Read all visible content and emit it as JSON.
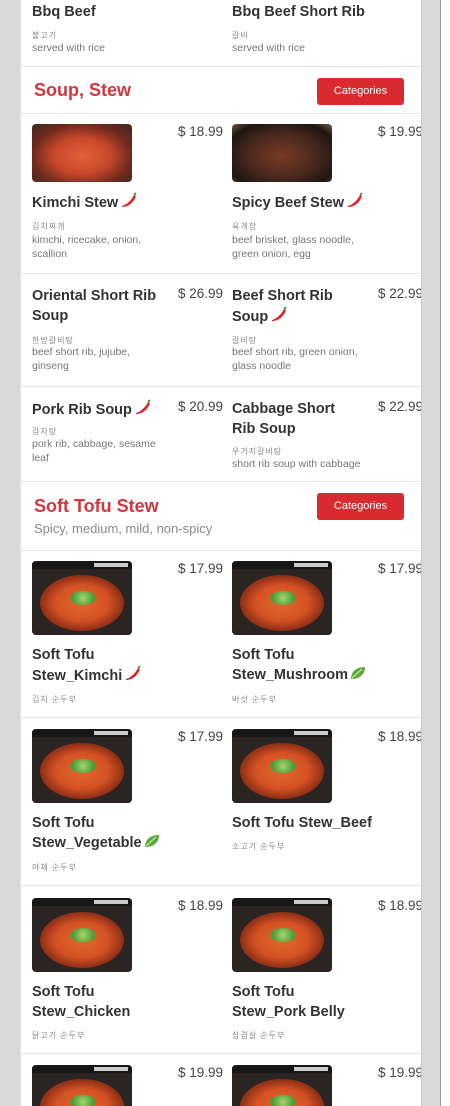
{
  "colors": {
    "accent": "#d92a2f",
    "title_red": "#d3363c"
  },
  "top_items": [
    {
      "name": "Bbq Beef",
      "korean": "불고기",
      "desc": "served with rice"
    },
    {
      "name": "Bbq Beef Short Rib",
      "korean": "갈비",
      "desc": "served with rice"
    }
  ],
  "sections": {
    "soup": {
      "title": "Soup, Stew",
      "categories_label": "Categories",
      "items": [
        {
          "name": "Kimchi Stew",
          "spicy": true,
          "price": "$ 18.99",
          "korean": "김치찌개",
          "desc": "kimchi, ricecake, onion, scallion",
          "image": "kimchi-stew"
        },
        {
          "name": "Spicy Beef Stew",
          "spicy": true,
          "price": "$ 19.99",
          "korean": "육개장",
          "desc": "beef brisket, glass noodle, green onion, egg",
          "image": "spicy-beef-stew"
        },
        {
          "name": "Oriental Short Rib Soup",
          "price": "$ 26.99",
          "korean": "한방갈비탕",
          "desc": "beef short rib, jujube, ginseng"
        },
        {
          "name": "Beef Short Rib Soup",
          "spicy": true,
          "price": "$ 22.99",
          "korean": "갈비탕",
          "desc": "beef short rib, green onion, glass noodle"
        },
        {
          "name": "Pork Rib Soup",
          "spicy": true,
          "price": "$ 20.99",
          "korean": "감자탕",
          "desc": "pork rib, cabbage, sesame leaf"
        },
        {
          "name": "Cabbage Short Rib Soup",
          "price": "$ 22.99",
          "korean": "우거지갈비탕",
          "desc": "short rib soup with cabbage"
        }
      ]
    },
    "tofu": {
      "title": "Soft Tofu Stew",
      "subtitle": "Spicy, medium, mild, non-spicy",
      "categories_label": "Categories",
      "items": [
        {
          "name": "Soft Tofu Stew_Kimchi",
          "tag": "spicy",
          "price": "$ 17.99",
          "korean": "김치 순두부"
        },
        {
          "name": "Soft Tofu Stew_Mushroom",
          "tag": "vegetarian",
          "price": "$ 17.99",
          "korean": "버섯 순두부"
        },
        {
          "name": "Soft Tofu Stew_Vegetable",
          "tag": "vegetarian",
          "price": "$ 17.99",
          "korean": "야채 순두부"
        },
        {
          "name": "Soft Tofu Stew_Beef",
          "price": "$ 18.99",
          "korean": "소고기 순두부"
        },
        {
          "name": "Soft Tofu Stew_Chicken",
          "price": "$ 18.99",
          "korean": "닭고기 순두부"
        },
        {
          "name": "Soft Tofu Stew_Pork Belly",
          "price": "$ 18.99",
          "korean": "삼겹살 순두부"
        },
        {
          "price": "$ 19.99"
        },
        {
          "price": "$ 19.99"
        }
      ]
    }
  },
  "icons": {
    "spicy": "red-chili-pepper-icon",
    "vegetarian": "green-leaf-icon"
  }
}
